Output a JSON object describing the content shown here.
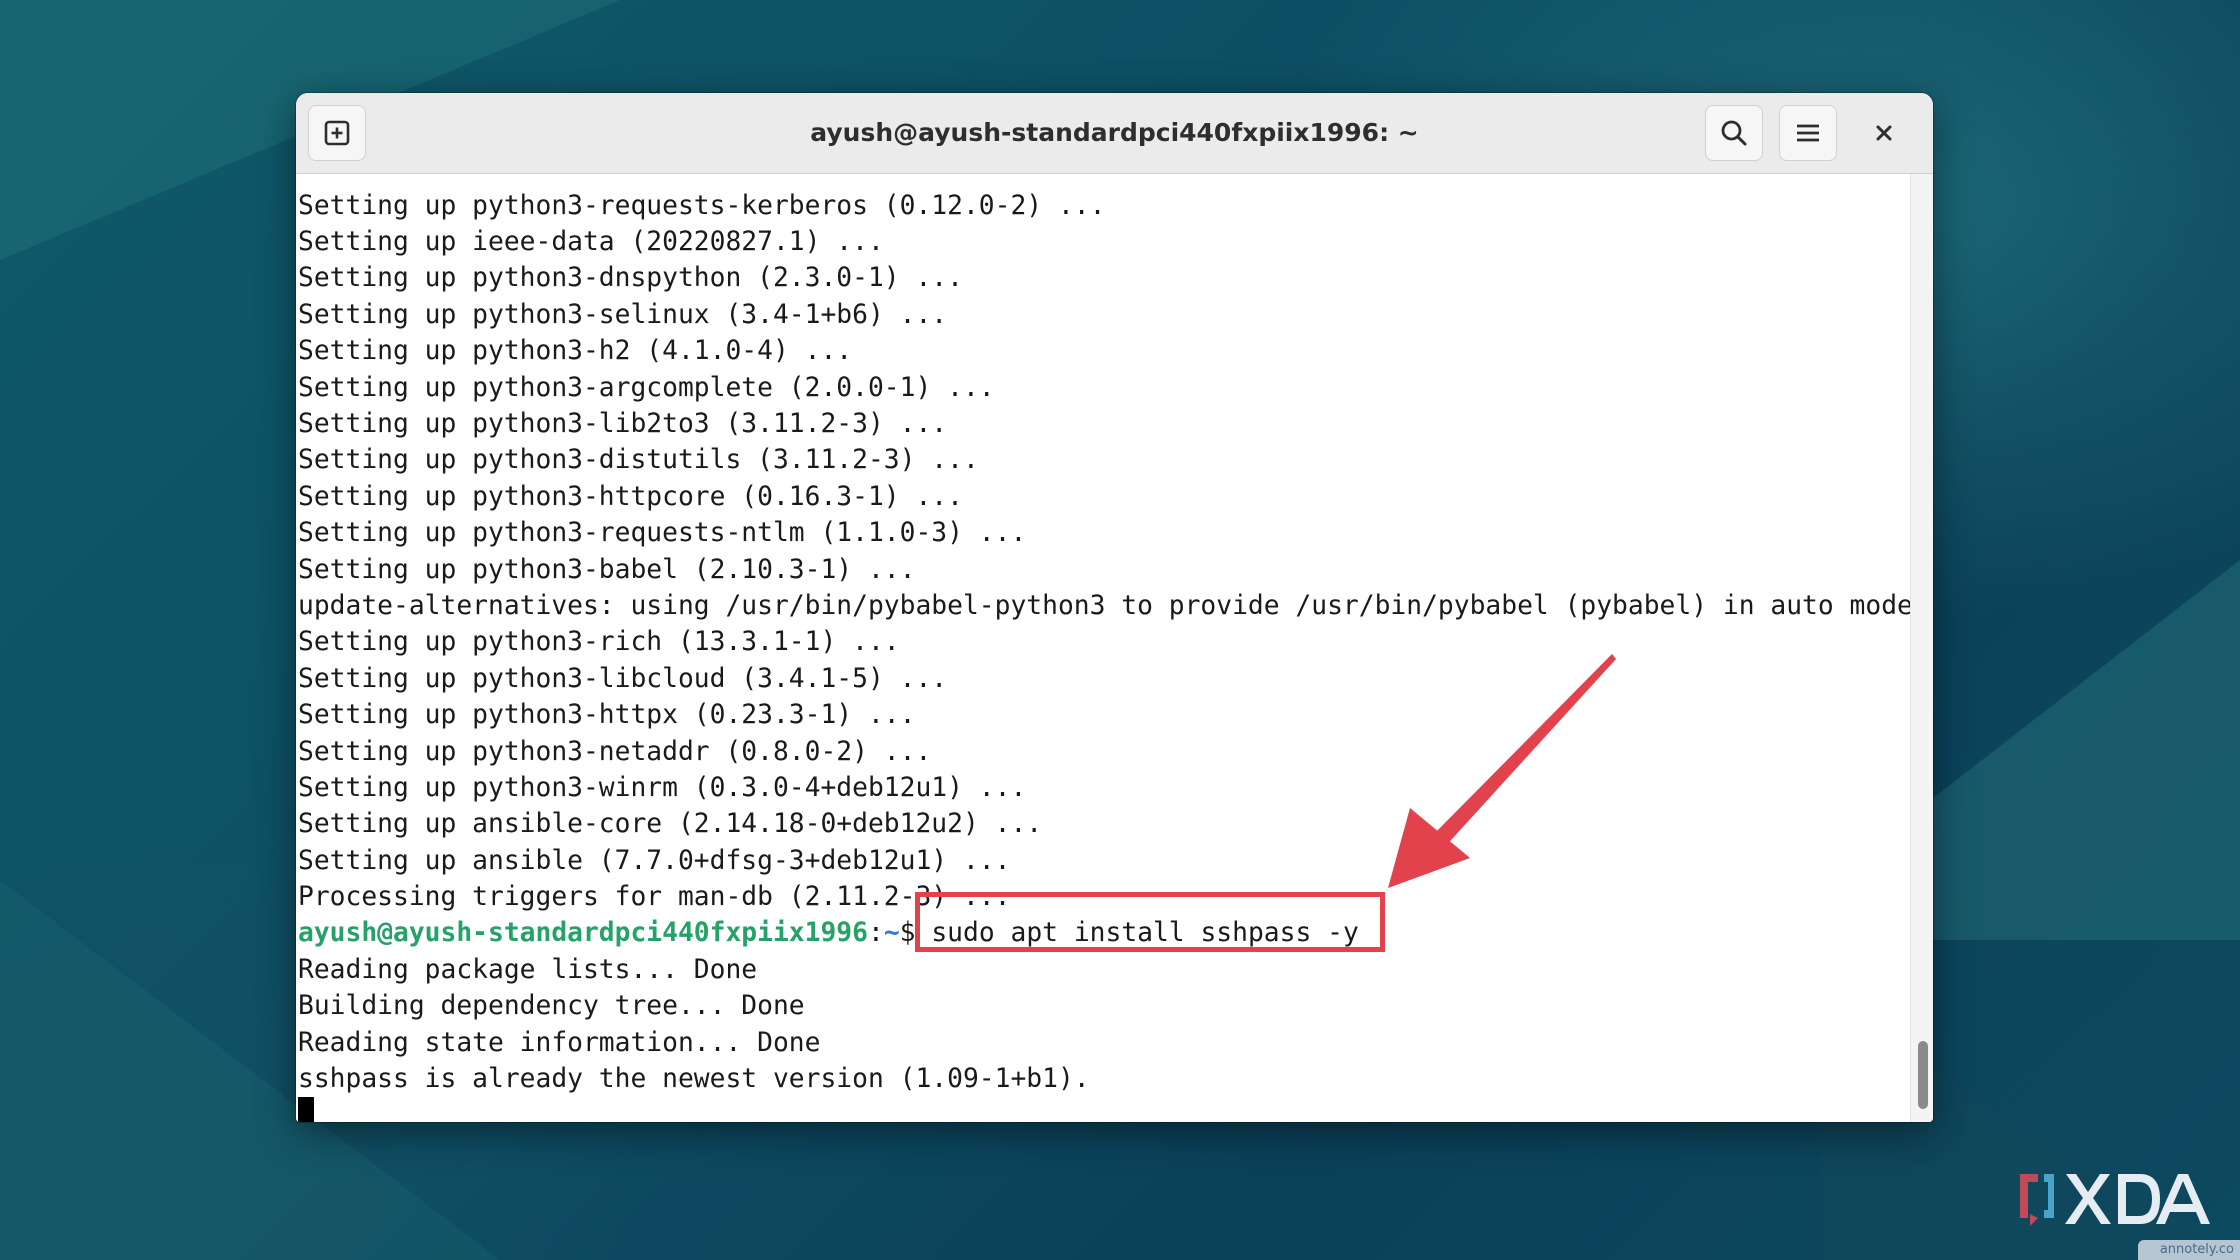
{
  "window": {
    "title": "ayush@ayush-standardpci440fxpiix1996: ~"
  },
  "headerbar": {
    "new_tab_icon": "new-tab-icon",
    "search_icon": "search-icon",
    "menu_icon": "hamburger-menu-icon",
    "close_icon": "close-icon"
  },
  "terminal": {
    "lines": [
      "Setting up python3-requests-kerberos (0.12.0-2) ...",
      "Setting up ieee-data (20220827.1) ...",
      "Setting up python3-dnspython (2.3.0-1) ...",
      "Setting up python3-selinux (3.4-1+b6) ...",
      "Setting up python3-h2 (4.1.0-4) ...",
      "Setting up python3-argcomplete (2.0.0-1) ...",
      "Setting up python3-lib2to3 (3.11.2-3) ...",
      "Setting up python3-distutils (3.11.2-3) ...",
      "Setting up python3-httpcore (0.16.3-1) ...",
      "Setting up python3-requests-ntlm (1.1.0-3) ...",
      "Setting up python3-babel (2.10.3-1) ...",
      "update-alternatives: using /usr/bin/pybabel-python3 to provide /usr/bin/pybabel (pybabel) in auto mode",
      "Setting up python3-rich (13.3.1-1) ...",
      "Setting up python3-libcloud (3.4.1-5) ...",
      "Setting up python3-httpx (0.23.3-1) ...",
      "Setting up python3-netaddr (0.8.0-2) ...",
      "Setting up python3-winrm (0.3.0-4+deb12u1) ...",
      "Setting up ansible-core (2.14.18-0+deb12u2) ...",
      "Setting up ansible (7.7.0+dfsg-3+deb12u1) ...",
      "Processing triggers for man-db (2.11.2-3) ..."
    ],
    "prompt": {
      "user_host": "ayush@ayush-standardpci440fxpiix1996",
      "separator": ":",
      "path": "~",
      "dollar": "$ ",
      "command": "sudo apt install sshpass -y"
    },
    "output": [
      "Reading package lists... Done",
      "Building dependency tree... Done",
      "Reading state information... Done",
      "sshpass is already the newest version (1.09-1+b1)."
    ]
  },
  "annotation": {
    "highlight_color": "#e2424b"
  },
  "branding": {
    "logo_text": "XDA",
    "watermark": "annotely.co"
  },
  "colors": {
    "prompt_user": "#26a269",
    "prompt_path": "#2a7bde",
    "terminal_bg": "#ffffff",
    "text": "#1a1a1a"
  }
}
